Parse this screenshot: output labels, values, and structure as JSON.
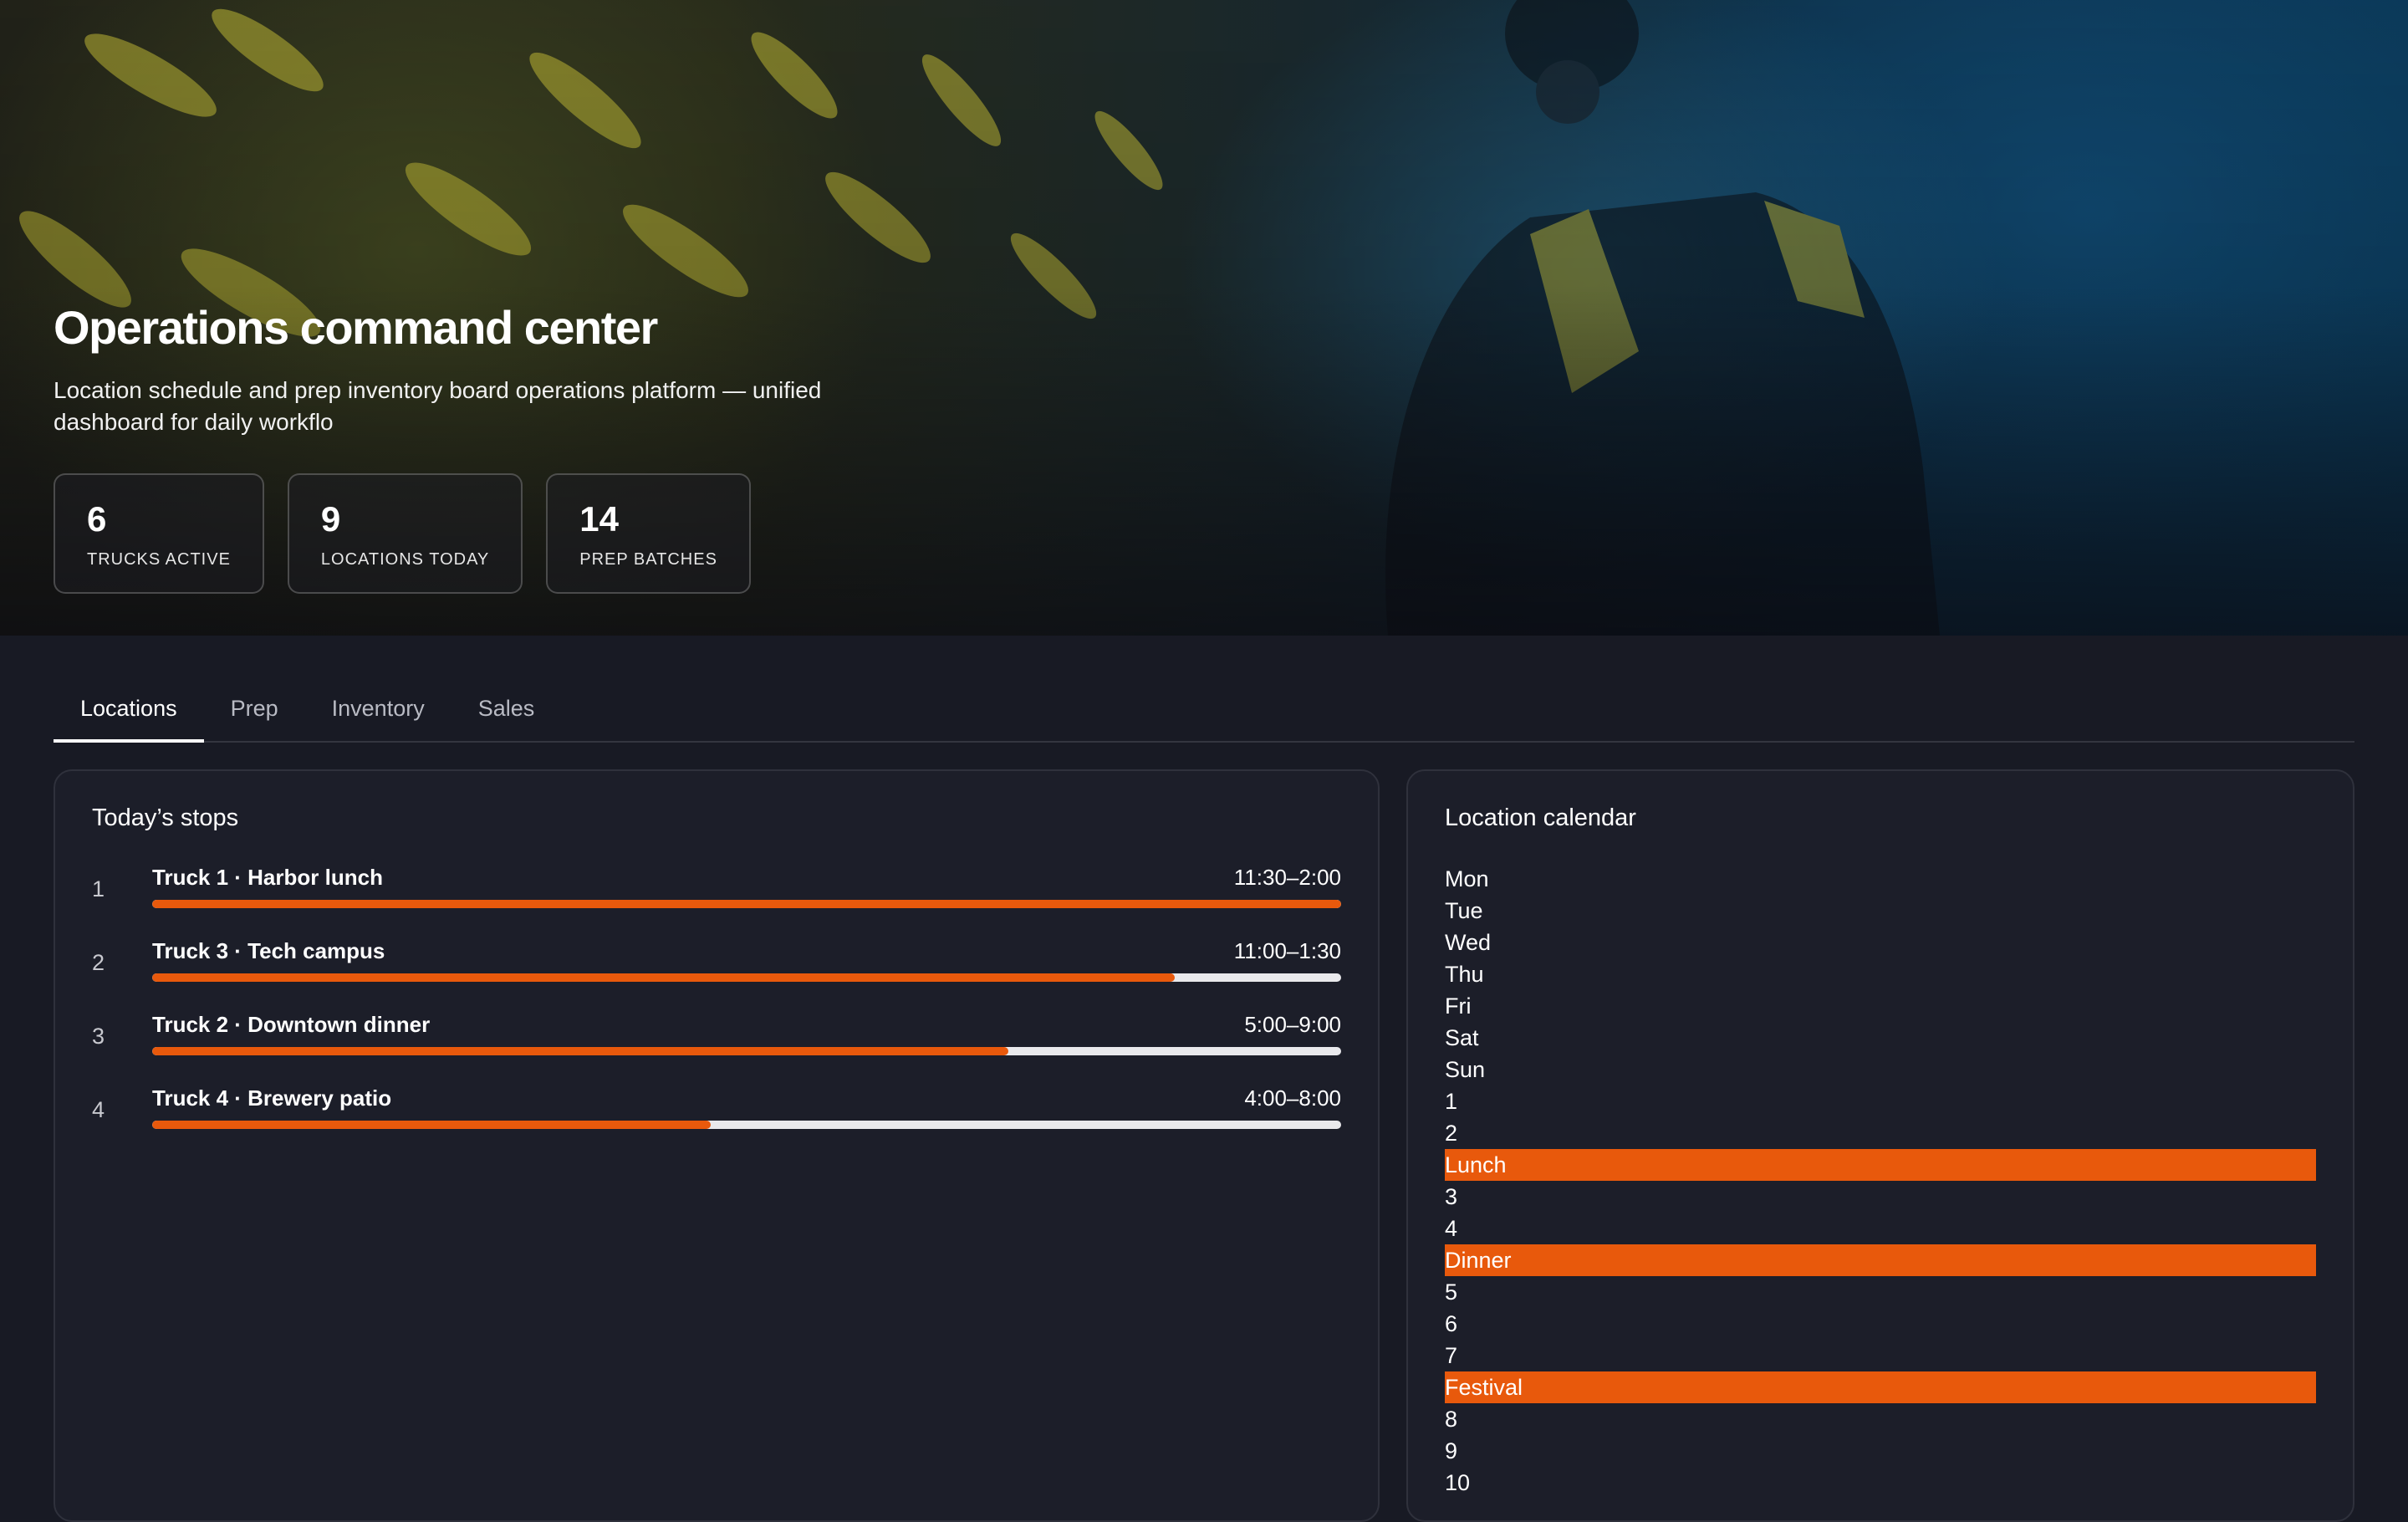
{
  "hero": {
    "title": "Operations command center",
    "subtitle": "Location schedule and prep inventory board operations platform — unified dashboard for daily workflo",
    "stats": [
      {
        "value": "6",
        "label": "TRUCKS ACTIVE"
      },
      {
        "value": "9",
        "label": "LOCATIONS TODAY"
      },
      {
        "value": "14",
        "label": "PREP BATCHES"
      }
    ]
  },
  "tabs": [
    "Locations",
    "Prep",
    "Inventory",
    "Sales"
  ],
  "active_tab": "Locations",
  "stops": {
    "title": "Today’s stops",
    "items": [
      {
        "num": "1",
        "name": "Truck 1 · Harbor lunch",
        "time": "11:30–2:00",
        "progress": 1.0
      },
      {
        "num": "2",
        "name": "Truck 3 · Tech campus",
        "time": "11:00–1:30",
        "progress": 0.86
      },
      {
        "num": "3",
        "name": "Truck 2 · Downtown dinner",
        "time": "5:00–9:00",
        "progress": 0.72
      },
      {
        "num": "4",
        "name": "Truck 4 · Brewery patio",
        "time": "4:00–8:00",
        "progress": 0.47
      }
    ],
    "colors": {
      "fill": "#e8590c",
      "track": "#e9e9ec"
    }
  },
  "calendar": {
    "title": "Location calendar",
    "items": [
      {
        "text": "Mon",
        "event": false
      },
      {
        "text": "Tue",
        "event": false
      },
      {
        "text": "Wed",
        "event": false
      },
      {
        "text": "Thu",
        "event": false
      },
      {
        "text": "Fri",
        "event": false
      },
      {
        "text": "Sat",
        "event": false
      },
      {
        "text": "Sun",
        "event": false
      },
      {
        "text": "1",
        "event": false
      },
      {
        "text": "2",
        "event": false
      },
      {
        "text": "Lunch",
        "event": true
      },
      {
        "text": "3",
        "event": false
      },
      {
        "text": "4",
        "event": false
      },
      {
        "text": "Dinner",
        "event": true
      },
      {
        "text": "5",
        "event": false
      },
      {
        "text": "6",
        "event": false
      },
      {
        "text": "7",
        "event": false
      },
      {
        "text": "Festival",
        "event": true
      },
      {
        "text": "8",
        "event": false
      },
      {
        "text": "9",
        "event": false
      },
      {
        "text": "10",
        "event": false
      }
    ],
    "colors": {
      "event": "#e8590c"
    }
  }
}
